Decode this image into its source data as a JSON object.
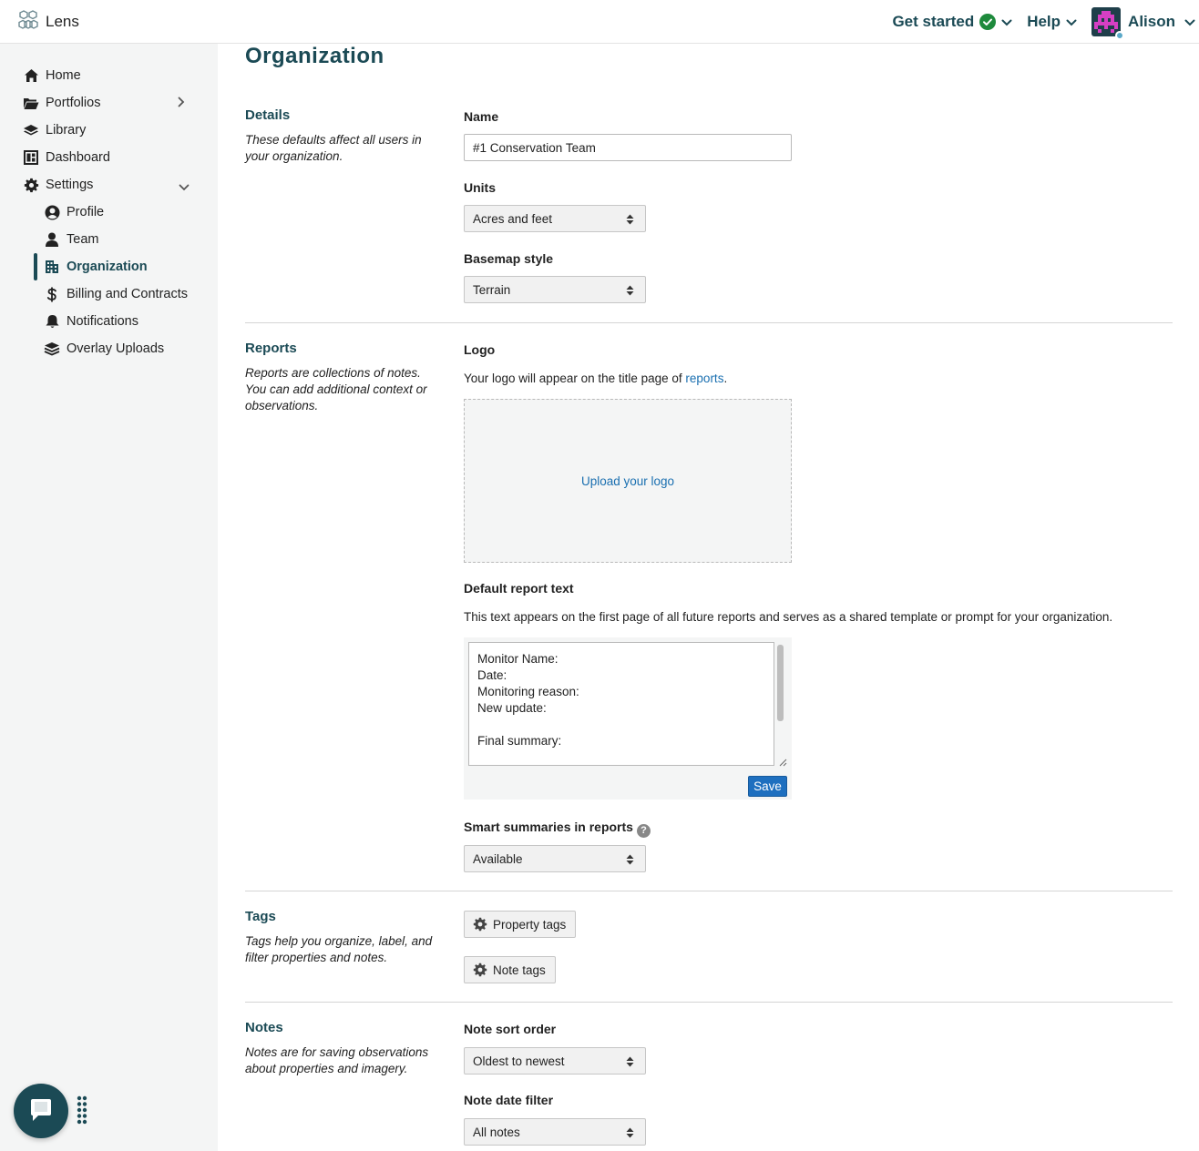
{
  "app": {
    "name": "Lens"
  },
  "topnav": {
    "get_started": "Get started",
    "help": "Help",
    "user": "Alison"
  },
  "sidebar": {
    "items": [
      {
        "label": "Home",
        "icon": "home-icon"
      },
      {
        "label": "Portfolios",
        "icon": "folder-icon"
      },
      {
        "label": "Library",
        "icon": "layers-icon"
      },
      {
        "label": "Dashboard",
        "icon": "dashboard-icon"
      },
      {
        "label": "Settings",
        "icon": "gear-icon"
      }
    ],
    "settings_items": [
      {
        "label": "Profile",
        "icon": "user-circle-icon"
      },
      {
        "label": "Team",
        "icon": "user-icon"
      },
      {
        "label": "Organization",
        "icon": "building-icon",
        "active": true
      },
      {
        "label": "Billing and Contracts",
        "icon": "dollar-icon"
      },
      {
        "label": "Notifications",
        "icon": "bell-icon"
      },
      {
        "label": "Overlay Uploads",
        "icon": "stack-icon"
      }
    ]
  },
  "page": {
    "title": "Organization"
  },
  "details": {
    "title": "Details",
    "description": "These defaults affect all users in your organization.",
    "name_label": "Name",
    "name_value": "#1 Conservation Team",
    "units_label": "Units",
    "units_value": "Acres and feet",
    "basemap_label": "Basemap style",
    "basemap_value": "Terrain"
  },
  "reports": {
    "title": "Reports",
    "description": "Reports are collections of notes. You can add additional context or observations.",
    "logo_label": "Logo",
    "logo_text_before": "Your logo will appear on the title page of ",
    "logo_text_link": "reports",
    "logo_text_after": ".",
    "upload_label": "Upload your logo",
    "default_text_label": "Default report text",
    "default_text_desc": "This text appears on the first page of all future reports and serves as a shared template or prompt for your organization.",
    "default_text_value": "Monitor Name:\nDate:\nMonitoring reason:\nNew update:\n\nFinal summary:",
    "save_label": "Save",
    "smart_label": "Smart summaries in reports",
    "smart_value": "Available"
  },
  "tags": {
    "title": "Tags",
    "description": "Tags help you organize, label, and filter properties and notes.",
    "property_tags": "Property tags",
    "note_tags": "Note tags"
  },
  "notes": {
    "title": "Notes",
    "description": "Notes are for saving observations about properties and imagery.",
    "sort_label": "Note sort order",
    "sort_value": "Oldest to newest",
    "date_filter_label": "Note date filter",
    "date_filter_value": "All notes"
  },
  "colors": {
    "accent": "#1b4a55",
    "link": "#1a6fb0",
    "button": "#1e6fbf",
    "success": "#1e8a3c"
  }
}
